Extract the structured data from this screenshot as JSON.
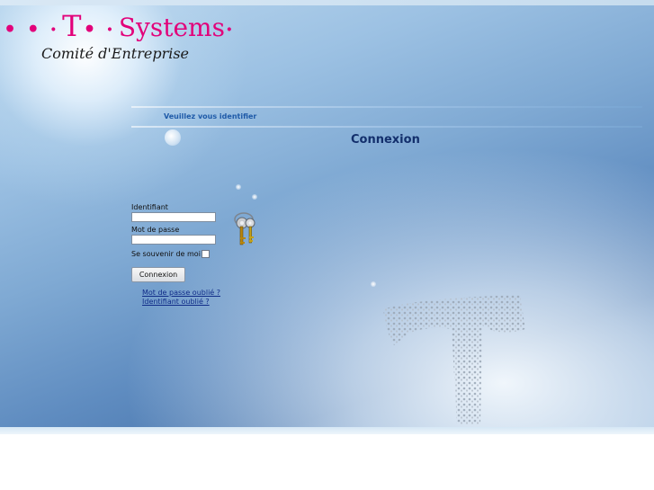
{
  "brand": {
    "dots_left": "• • ·",
    "t_letter": "T",
    "dots_mid": "• ·",
    "name": "Systems",
    "dot_right": "·",
    "subtitle": "Comité d'Entreprise",
    "color": "#e2007a"
  },
  "header": {
    "identify_text": "Veuillez vous identifier"
  },
  "main": {
    "title": "Connexion"
  },
  "form": {
    "username_label": "Identifiant",
    "username_value": "",
    "password_label": "Mot de passe",
    "password_value": "",
    "remember_label": "Se souvenir de moi",
    "remember_checked": false,
    "submit_label": "Connexion"
  },
  "links": {
    "forgot_password": "Mot de passe oublié ?",
    "forgot_username": "Identifiant oublié ?"
  },
  "icons": {
    "keys": "keys-icon",
    "decorative_t": "t-watermark-icon"
  }
}
